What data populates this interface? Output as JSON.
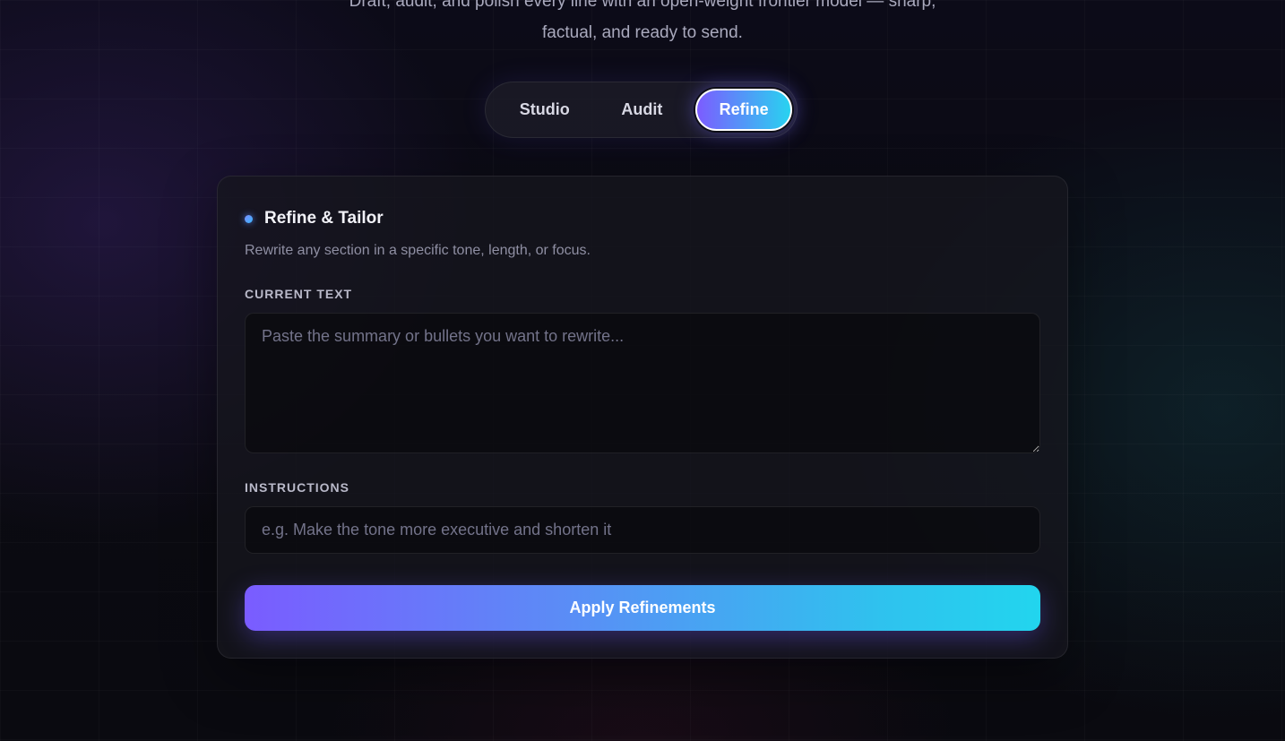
{
  "header": {
    "subtitle_line1": "Draft, audit, and polish every line with an open-weight frontier model — sharp,",
    "subtitle_line2": "factual, and ready to send."
  },
  "tabs": [
    {
      "label": "Studio",
      "active": false
    },
    {
      "label": "Audit",
      "active": false
    },
    {
      "label": "Refine",
      "active": true
    }
  ],
  "card": {
    "title": "Refine & Tailor",
    "description": "Rewrite any section in a specific tone, length, or focus.",
    "current_text_label": "CURRENT TEXT",
    "current_text_placeholder": "Paste the summary or bullets you want to rewrite...",
    "current_text_value": "",
    "instructions_label": "INSTRUCTIONS",
    "instructions_placeholder": "e.g. Make the tone more executive and shorten it",
    "instructions_value": "",
    "apply_label": "Apply Refinements"
  },
  "colors": {
    "accent_start": "#7c5cff",
    "accent_end": "#28d3f0",
    "background": "#0b0b12"
  }
}
